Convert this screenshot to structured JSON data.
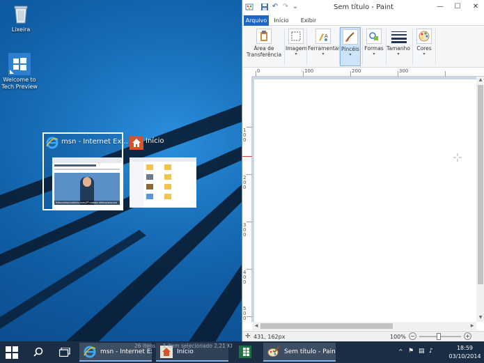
{
  "desktop": {
    "icons": [
      {
        "label": "Lixeira",
        "icon": "recycle-bin-icon"
      },
      {
        "label": "Welcome to Tech Preview",
        "icon": "windows-logo-icon"
      }
    ]
  },
  "switcher": {
    "items": [
      {
        "title": "msn - Internet Ex...",
        "icon": "internet-explorer-icon",
        "selected": true
      },
      {
        "title": "Início",
        "icon": "home-icon",
        "selected": false
      }
    ],
    "msn_caption": "Estocolmo/cnbbrbc.com/2ª rodada atletas/arquivo"
  },
  "paint": {
    "title": "Sem título - Paint",
    "tabs": [
      "Arquivo",
      "Início",
      "Exibir"
    ],
    "ribbon": [
      {
        "label": "Área de Transferência",
        "icon": "clipboard-icon"
      },
      {
        "label": "Imagem",
        "icon": "image-select-icon"
      },
      {
        "label": "Ferramentas",
        "icon": "tools-icon"
      },
      {
        "label": "Pincéis",
        "icon": "brush-icon",
        "active": true
      },
      {
        "label": "Formas",
        "icon": "shapes-icon"
      },
      {
        "label": "Tamanho",
        "icon": "line-size-icon"
      },
      {
        "label": "Cores",
        "icon": "palette-icon"
      }
    ],
    "ruler_h": [
      "0",
      "100",
      "200",
      "300"
    ],
    "ruler_v": [
      "100",
      "200",
      "300",
      "400",
      "500"
    ],
    "status": {
      "position": "431, 162px",
      "zoom": "100%"
    }
  },
  "taskbar": {
    "tasks": [
      {
        "label": "msn - Internet Ex...",
        "icon": "internet-explorer-icon"
      },
      {
        "label": "Início",
        "icon": "home-icon"
      },
      {
        "label": "",
        "icon": "excel-icon"
      },
      {
        "label": "Sem título - Paint",
        "icon": "paint-icon"
      }
    ],
    "explorer_ghost": {
      "items": "26 itens",
      "selected": "1 item selecionado  2,21 KB"
    },
    "clock": {
      "time": "18:59",
      "date": "03/10/2014"
    }
  },
  "colors": {
    "accent": "#1d67c4",
    "taskbar": "#1a2d44",
    "desktop": "#0f5fa8"
  }
}
